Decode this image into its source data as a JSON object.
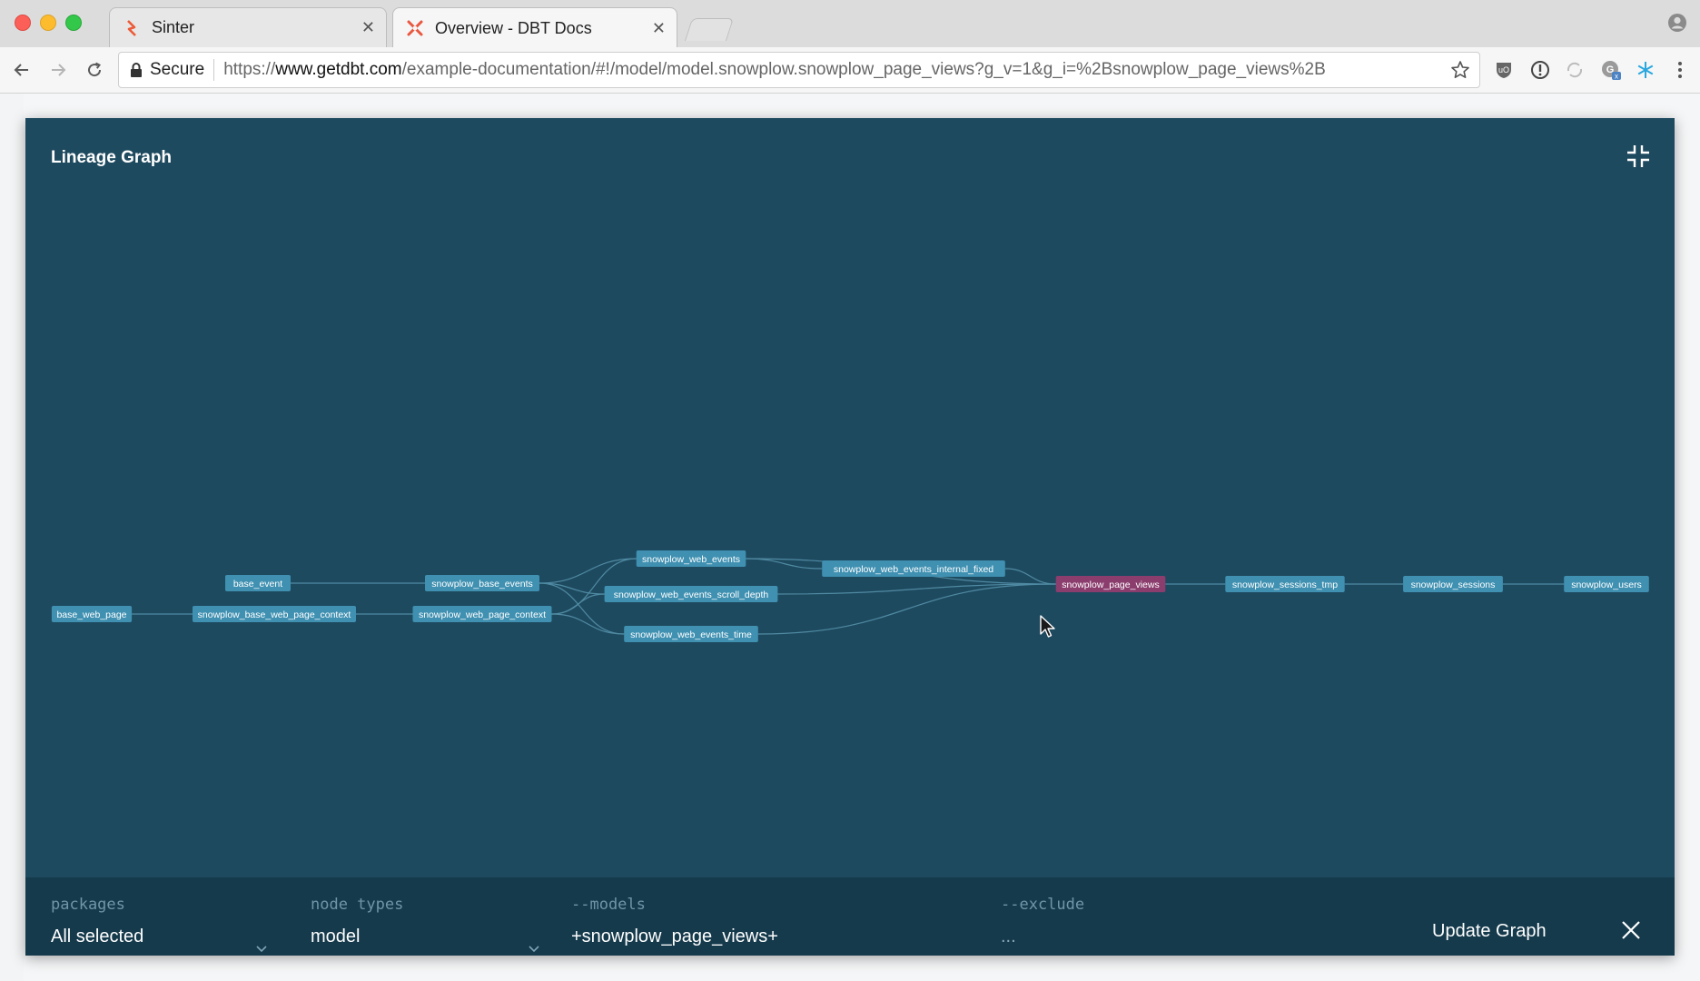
{
  "browser": {
    "tabs": [
      {
        "title": "Sinter",
        "favicon": "sinter-logo-icon",
        "active": false
      },
      {
        "title": "Overview - DBT Docs",
        "favicon": "dbt-logo-icon",
        "active": true
      }
    ],
    "omnibox": {
      "secure_label": "Secure",
      "url_scheme": "https://",
      "url_host": "www.getdbt.com",
      "url_path": "/example-documentation/#!/model/model.snowplow.snowplow_page_views?g_v=1&g_i=%2Bsnowplow_page_views%2B"
    },
    "extensions": [
      "ublock-icon",
      "info-icon",
      "sync-icon",
      "grammarly-icon",
      "snowflake-icon",
      "menu-dots-icon"
    ]
  },
  "modal": {
    "title": "Lineage Graph"
  },
  "graph": {
    "nodes": [
      {
        "id": "base_web_page",
        "label": "base_web_page",
        "highlight": false
      },
      {
        "id": "base_event",
        "label": "base_event",
        "highlight": false
      },
      {
        "id": "snowplow_base_web_page_context",
        "label": "snowplow_base_web_page_context",
        "highlight": false
      },
      {
        "id": "snowplow_base_events",
        "label": "snowplow_base_events",
        "highlight": false
      },
      {
        "id": "snowplow_web_page_context",
        "label": "snowplow_web_page_context",
        "highlight": false
      },
      {
        "id": "snowplow_web_events",
        "label": "snowplow_web_events",
        "highlight": false
      },
      {
        "id": "snowplow_web_events_scroll_depth",
        "label": "snowplow_web_events_scroll_depth",
        "highlight": false
      },
      {
        "id": "snowplow_web_events_time",
        "label": "snowplow_web_events_time",
        "highlight": false
      },
      {
        "id": "snowplow_web_events_internal_fixed",
        "label": "snowplow_web_events_internal_fixed",
        "highlight": false
      },
      {
        "id": "snowplow_page_views",
        "label": "snowplow_page_views",
        "highlight": true
      },
      {
        "id": "snowplow_sessions_tmp",
        "label": "snowplow_sessions_tmp",
        "highlight": false
      },
      {
        "id": "snowplow_sessions",
        "label": "snowplow_sessions",
        "highlight": false
      },
      {
        "id": "snowplow_users",
        "label": "snowplow_users",
        "highlight": false
      }
    ],
    "edges": [
      [
        "base_event",
        "snowplow_base_events"
      ],
      [
        "base_web_page",
        "snowplow_base_web_page_context"
      ],
      [
        "snowplow_base_web_page_context",
        "snowplow_web_page_context"
      ],
      [
        "snowplow_base_events",
        "snowplow_web_events"
      ],
      [
        "snowplow_base_events",
        "snowplow_web_events_scroll_depth"
      ],
      [
        "snowplow_base_events",
        "snowplow_web_events_time"
      ],
      [
        "snowplow_web_page_context",
        "snowplow_web_events"
      ],
      [
        "snowplow_web_page_context",
        "snowplow_web_events_scroll_depth"
      ],
      [
        "snowplow_web_page_context",
        "snowplow_web_events_time"
      ],
      [
        "snowplow_web_events",
        "snowplow_web_events_internal_fixed"
      ],
      [
        "snowplow_web_events",
        "snowplow_page_views"
      ],
      [
        "snowplow_web_events_internal_fixed",
        "snowplow_page_views"
      ],
      [
        "snowplow_web_events_scroll_depth",
        "snowplow_page_views"
      ],
      [
        "snowplow_web_events_time",
        "snowplow_page_views"
      ],
      [
        "snowplow_page_views",
        "snowplow_sessions_tmp"
      ],
      [
        "snowplow_sessions_tmp",
        "snowplow_sessions"
      ],
      [
        "snowplow_sessions",
        "snowplow_users"
      ]
    ],
    "colors": {
      "node": "#3f90b1",
      "highlight": "#8b3d6e",
      "edge": "#4f8aa3",
      "background": "#1e4a5f"
    }
  },
  "controls": {
    "packages": {
      "label": "packages",
      "value": "All selected"
    },
    "node_types": {
      "label": "node types",
      "value": "model"
    },
    "models": {
      "label": "--models",
      "value": "+snowplow_page_views+"
    },
    "exclude": {
      "label": "--exclude",
      "value": "..."
    },
    "update_label": "Update Graph"
  }
}
